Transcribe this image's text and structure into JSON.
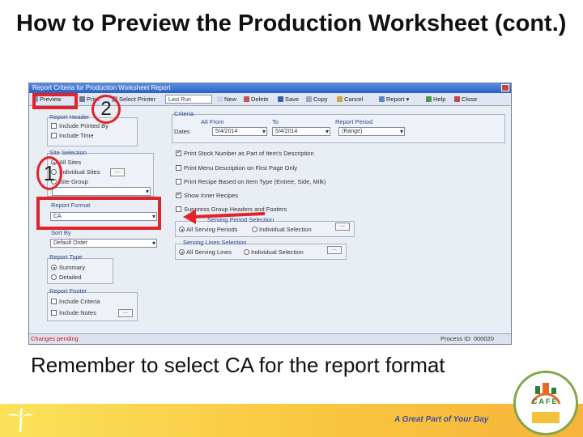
{
  "slide": {
    "title": "How to Preview the Production Worksheet (cont.)",
    "caption": "Remember to select CA for the report format",
    "tagline": "A Great Part of Your Day",
    "logo_text": "CAFE",
    "step_1": "1",
    "step_2": "2"
  },
  "window": {
    "title": "Report Criteria for Production Worksheet Report",
    "toolbar": {
      "preview": "Preview",
      "print": "Print",
      "select_printer": "Select Printer",
      "report_select": "Last Run",
      "new": "New",
      "delete": "Delete",
      "save": "Save",
      "copy": "Copy",
      "cancel": "Cancel",
      "report": "Report",
      "help": "Help",
      "close": "Close"
    },
    "left": {
      "report_header_label": "Report Header",
      "include_printed_by": "Include Printed By",
      "include_time": "Include Time",
      "site_selection_label": "Site Selection",
      "all_sites": "All Sites",
      "individual_sites": "Individual Sites",
      "site_group": "Site Group",
      "report_format_label": "Report Format",
      "report_format_value": "CA",
      "sort_by_label": "Sort By",
      "sort_by_value": "Default Order",
      "report_type_label": "Report Type",
      "summary": "Summary",
      "detailed": "Detailed",
      "report_footer_label": "Report Footer",
      "include_criteria": "Include Criteria",
      "include_notes": "Include Notes",
      "ellipsis": "..."
    },
    "right": {
      "criteria_label": "Criteria",
      "alt_from_label": "Alt From",
      "to_label": "To",
      "report_period_label": "Report Period",
      "dates_label": "Dates",
      "from_date": "5/4/2014",
      "to_date": "5/4/2014",
      "period_value": "(Range)",
      "opt_stock_number": "Print Stock Number as Part of Item's Description",
      "opt_menu_desc": "Print Menu Description on First Page Only",
      "opt_recipe": "Print Recipe Based on Item Type (Entree, Side, Milk)",
      "opt_inner_recipes": "Show Inner Recipes",
      "opt_suppress": "Suppress Group Headers and Footers",
      "serving_periods_label": "Serving Period Selection",
      "all_serving_periods": "All Serving Periods",
      "individual_selection": "Individual Selection",
      "serving_lines_label": "Serving Lines Selection",
      "all_serving_lines": "All Serving Lines",
      "individual_selection_2": "Individual Selection",
      "ellipsis": "...",
      "ellipsis_2": "..."
    },
    "status": {
      "left": "Changes pending",
      "right": "Process ID: 000020"
    }
  },
  "colors": {
    "highlight": "#e0242a",
    "footer_yellow": "#f9c640",
    "tagline_blue": "#3a4fa0"
  }
}
